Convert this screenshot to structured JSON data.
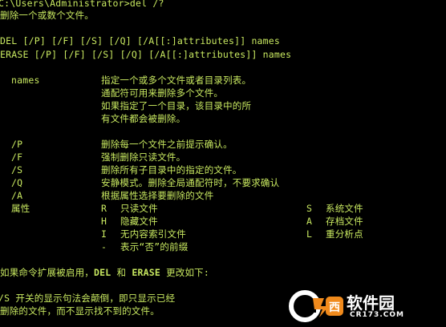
{
  "colors": {
    "background": "#000000",
    "text": "#c8e860",
    "watermark_orange": "#f08a1c",
    "watermark_white": "#ffffff"
  },
  "console": {
    "prompt_line": "C:\\Users\\Administrator>del /?",
    "intro": "删除一个或数个文件。",
    "syntax_del": "DEL [/P] [/F] [/S] [/Q] [/A[[:]attributes]] names",
    "syntax_erase": "ERASE [/P] [/F] [/S] [/Q] [/A[[:]attributes]] names",
    "names_label": "names",
    "names_desc": [
      "指定一个或多个文件或者目录列表。",
      "通配符可用来删除多个文件。",
      "如果指定了一个目录，该目录中的所",
      "有文件都会被删除。"
    ],
    "switches": [
      {
        "flag": "/P",
        "desc": "删除每一个文件之前提示确认。"
      },
      {
        "flag": "/F",
        "desc": "强制删除只读文件。"
      },
      {
        "flag": "/S",
        "desc": "删除所有子目录中的指定的文件。"
      },
      {
        "flag": "/Q",
        "desc": "安静模式。删除全局通配符时，不要求确认"
      },
      {
        "flag": "/A",
        "desc": "根据属性选择要删除的文件"
      }
    ],
    "attributes_label": "属性",
    "attributes_left": [
      {
        "code": "R",
        "desc": "只读文件"
      },
      {
        "code": "H",
        "desc": "隐藏文件"
      },
      {
        "code": "I",
        "desc": "无内容索引文件"
      },
      {
        "code": "-",
        "desc": "表示“否”的前缀"
      }
    ],
    "attributes_right": [
      {
        "code": "S",
        "desc": "系统文件"
      },
      {
        "code": "A",
        "desc": "存档文件"
      },
      {
        "code": "L",
        "desc": "重分析点"
      }
    ],
    "ext_line_pre": "如果命令扩展被启用，",
    "ext_del": "DEL",
    "ext_and": " 和 ",
    "ext_erase": "ERASE",
    "ext_line_post": " 更改如下:",
    "s_line_1": "/S 开关的显示句法会颠倒，即只显示已经",
    "s_line_2": "删除的文件，而不显示找不到的文件。"
  },
  "watermark": {
    "site_name": "软件园",
    "domain": "CR173.COM"
  }
}
